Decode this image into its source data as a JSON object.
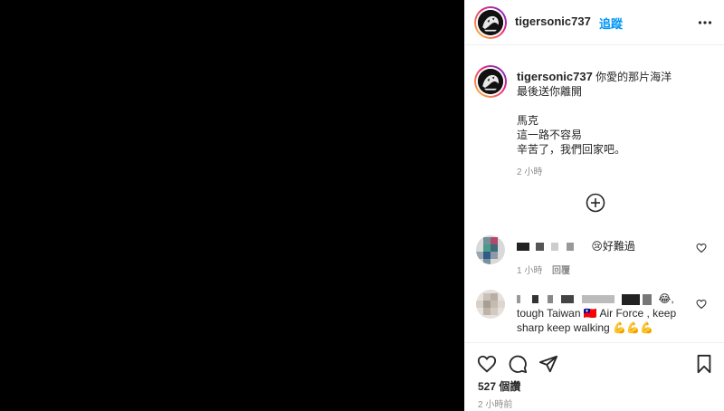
{
  "post": {
    "username": "tigersonic737",
    "follow_label": "追蹤",
    "caption": {
      "line1": "你愛的那片海洋",
      "line2": "最後送你離開",
      "line3": "馬克",
      "line4": "這一路不容易",
      "line5": "辛苦了，我們回家吧。"
    },
    "caption_time": "2 小時"
  },
  "comments": [
    {
      "text": "😢好難過",
      "time": "1 小時",
      "reply_label": "回覆"
    },
    {
      "text_line1": "tough Taiwan 🇹🇼 Air Force , keep",
      "text_line2": "sharp keep walking 💪💪💪",
      "trailing_emoji": "😂,"
    }
  ],
  "footer": {
    "likes": "527 個讚",
    "time_ago": "2 小時前"
  },
  "icons": {
    "more": "more-horizontal-icon",
    "load_more": "plus-circle-icon",
    "like": "heart-icon",
    "comment": "comment-icon",
    "share": "send-icon",
    "save": "bookmark-icon"
  },
  "colors": {
    "follow": "#0095f6",
    "media_background": "#000000",
    "muted_text": "#8e8e8e"
  }
}
